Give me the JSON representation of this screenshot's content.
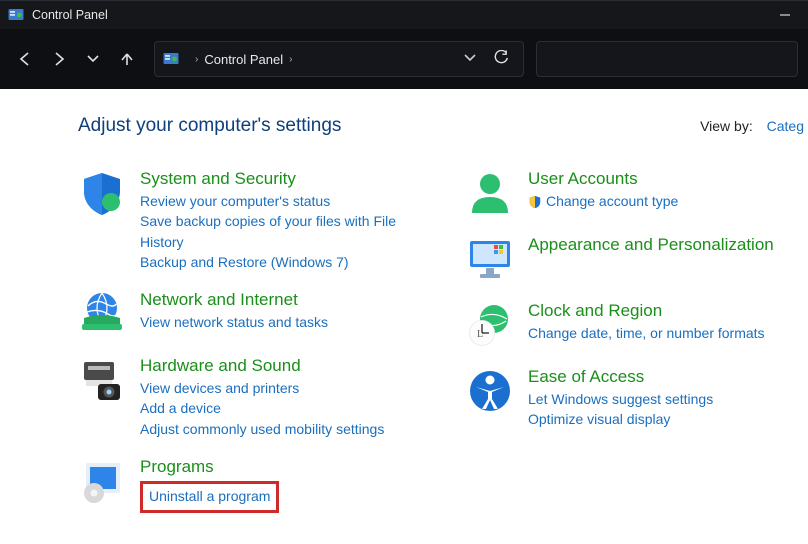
{
  "window": {
    "title": "Control Panel"
  },
  "address": {
    "crumb": "Control Panel"
  },
  "header": {
    "title": "Adjust your computer's settings",
    "view_by_label": "View by:",
    "view_by_value": "Categ"
  },
  "categories": {
    "system_security": {
      "title": "System and Security",
      "links": [
        "Review your computer's status",
        "Save backup copies of your files with File History",
        "Backup and Restore (Windows 7)"
      ]
    },
    "network_internet": {
      "title": "Network and Internet",
      "links": [
        "View network status and tasks"
      ]
    },
    "hardware_sound": {
      "title": "Hardware and Sound",
      "links": [
        "View devices and printers",
        "Add a device",
        "Adjust commonly used mobility settings"
      ]
    },
    "programs": {
      "title": "Programs",
      "links": [
        "Uninstall a program"
      ]
    },
    "user_accounts": {
      "title": "User Accounts",
      "links": [
        "Change account type"
      ]
    },
    "appearance": {
      "title": "Appearance and Personalization"
    },
    "clock_region": {
      "title": "Clock and Region",
      "links": [
        "Change date, time, or number formats"
      ]
    },
    "ease_of_access": {
      "title": "Ease of Access",
      "links": [
        "Let Windows suggest settings",
        "Optimize visual display"
      ]
    }
  }
}
